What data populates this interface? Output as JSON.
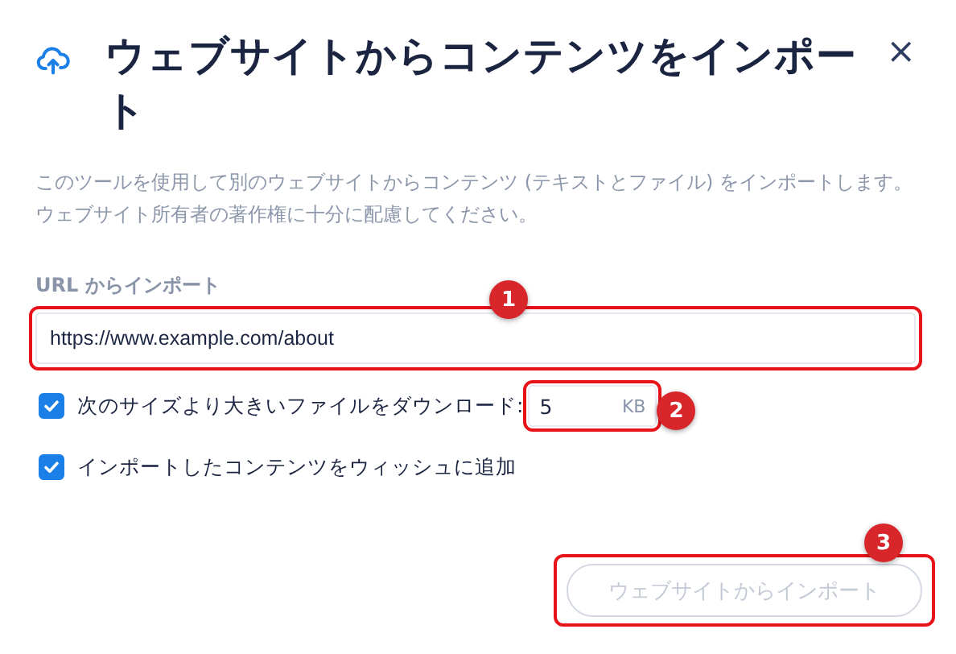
{
  "dialog": {
    "title": "ウェブサイトからコンテンツをインポート",
    "close": "×",
    "description": "このツールを使用して別のウェブサイトからコンテンツ (テキストとファイル) をインポートします。ウェブサイト所有者の著作権に十分に配慮してください。"
  },
  "url_field": {
    "label": "URL からインポート",
    "value": "https://www.example.com/about",
    "annotation": "1"
  },
  "options": [
    {
      "kind": "size",
      "label": "次のサイズより大きいファイルをダウンロード:",
      "checked": true,
      "value": "5",
      "unit": "KB",
      "annotation": "2"
    },
    {
      "kind": "plain",
      "label": "インポートしたコンテンツをウィッシュに追加",
      "checked": true
    }
  ],
  "import_button": {
    "label": "ウェブサイトからインポート",
    "disabled": true,
    "annotation": "3"
  }
}
